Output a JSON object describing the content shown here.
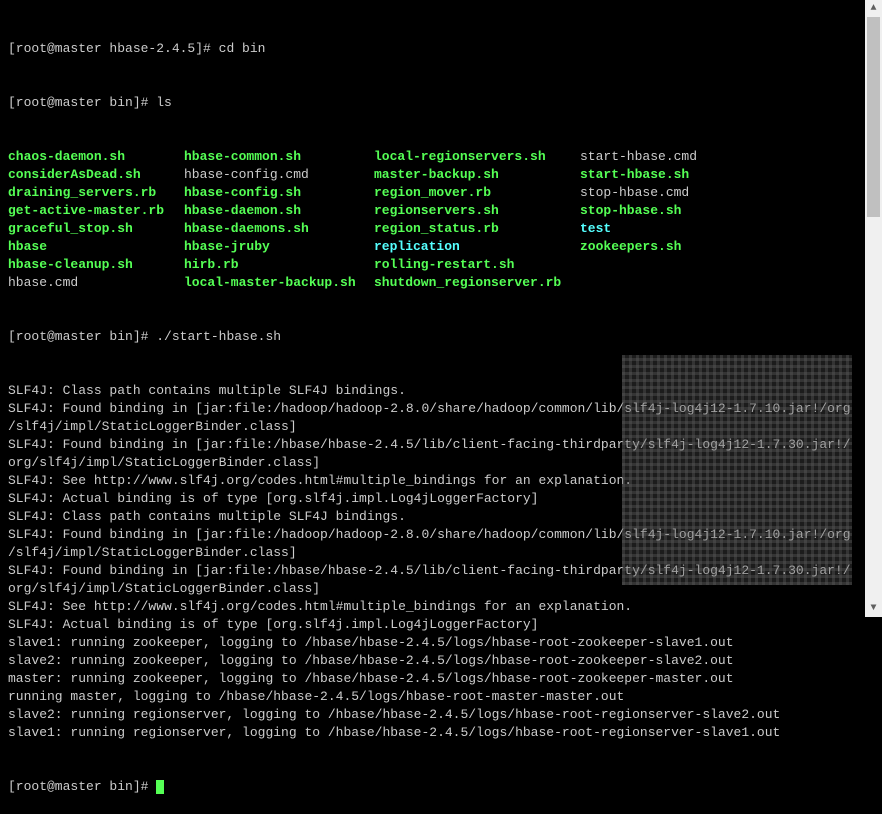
{
  "prompts": {
    "p1": "[root@master hbase-2.4.5]# ",
    "p2": "[root@master bin]# ",
    "cmd1": "cd bin",
    "cmd2": "ls",
    "cmd3": "./start-hbase.sh"
  },
  "files": [
    {
      "c0": {
        "t": "chaos-daemon.sh",
        "c": "green"
      },
      "c1": {
        "t": "hbase-common.sh",
        "c": "green"
      },
      "c2": {
        "t": "local-regionservers.sh",
        "c": "green"
      },
      "c3": {
        "t": "start-hbase.cmd",
        "c": "white"
      }
    },
    {
      "c0": {
        "t": "considerAsDead.sh",
        "c": "green"
      },
      "c1": {
        "t": "hbase-config.cmd",
        "c": "white"
      },
      "c2": {
        "t": "master-backup.sh",
        "c": "green"
      },
      "c3": {
        "t": "start-hbase.sh",
        "c": "green"
      }
    },
    {
      "c0": {
        "t": "draining_servers.rb",
        "c": "green"
      },
      "c1": {
        "t": "hbase-config.sh",
        "c": "green"
      },
      "c2": {
        "t": "region_mover.rb",
        "c": "green"
      },
      "c3": {
        "t": "stop-hbase.cmd",
        "c": "white"
      }
    },
    {
      "c0": {
        "t": "get-active-master.rb",
        "c": "green"
      },
      "c1": {
        "t": "hbase-daemon.sh",
        "c": "green"
      },
      "c2": {
        "t": "regionservers.sh",
        "c": "green"
      },
      "c3": {
        "t": "stop-hbase.sh",
        "c": "green"
      }
    },
    {
      "c0": {
        "t": "graceful_stop.sh",
        "c": "green"
      },
      "c1": {
        "t": "hbase-daemons.sh",
        "c": "green"
      },
      "c2": {
        "t": "region_status.rb",
        "c": "green"
      },
      "c3": {
        "t": "test",
        "c": "cyan"
      }
    },
    {
      "c0": {
        "t": "hbase",
        "c": "green"
      },
      "c1": {
        "t": "hbase-jruby",
        "c": "green"
      },
      "c2": {
        "t": "replication",
        "c": "cyan"
      },
      "c3": {
        "t": "zookeepers.sh",
        "c": "green"
      }
    },
    {
      "c0": {
        "t": "hbase-cleanup.sh",
        "c": "green"
      },
      "c1": {
        "t": "hirb.rb",
        "c": "green"
      },
      "c2": {
        "t": "rolling-restart.sh",
        "c": "green"
      },
      "c3": {
        "t": "",
        "c": "white"
      }
    },
    {
      "c0": {
        "t": "hbase.cmd",
        "c": "white"
      },
      "c1": {
        "t": "local-master-backup.sh",
        "c": "green"
      },
      "c2": {
        "t": "shutdown_regionserver.rb",
        "c": "green"
      },
      "c3": {
        "t": "",
        "c": "white"
      }
    }
  ],
  "output": [
    "SLF4J: Class path contains multiple SLF4J bindings.",
    "SLF4J: Found binding in [jar:file:/hadoop/hadoop-2.8.0/share/hadoop/common/lib/slf4j-log4j12-1.7.10.jar!/org/slf4j/impl/StaticLoggerBinder.class]",
    "SLF4J: Found binding in [jar:file:/hbase/hbase-2.4.5/lib/client-facing-thirdparty/slf4j-log4j12-1.7.30.jar!/org/slf4j/impl/StaticLoggerBinder.class]",
    "SLF4J: See http://www.slf4j.org/codes.html#multiple_bindings for an explanation.",
    "SLF4J: Actual binding is of type [org.slf4j.impl.Log4jLoggerFactory]",
    "SLF4J: Class path contains multiple SLF4J bindings.",
    "SLF4J: Found binding in [jar:file:/hadoop/hadoop-2.8.0/share/hadoop/common/lib/slf4j-log4j12-1.7.10.jar!/org/slf4j/impl/StaticLoggerBinder.class]",
    "SLF4J: Found binding in [jar:file:/hbase/hbase-2.4.5/lib/client-facing-thirdparty/slf4j-log4j12-1.7.30.jar!/org/slf4j/impl/StaticLoggerBinder.class]",
    "SLF4J: See http://www.slf4j.org/codes.html#multiple_bindings for an explanation.",
    "SLF4J: Actual binding is of type [org.slf4j.impl.Log4jLoggerFactory]",
    "slave1: running zookeeper, logging to /hbase/hbase-2.4.5/logs/hbase-root-zookeeper-slave1.out",
    "slave2: running zookeeper, logging to /hbase/hbase-2.4.5/logs/hbase-root-zookeeper-slave2.out",
    "master: running zookeeper, logging to /hbase/hbase-2.4.5/logs/hbase-root-zookeeper-master.out",
    "running master, logging to /hbase/hbase-2.4.5/logs/hbase-root-master-master.out",
    "slave2: running regionserver, logging to /hbase/hbase-2.4.5/logs/hbase-root-regionserver-slave2.out",
    "slave1: running regionserver, logging to /hbase/hbase-2.4.5/logs/hbase-root-regionserver-slave1.out"
  ]
}
